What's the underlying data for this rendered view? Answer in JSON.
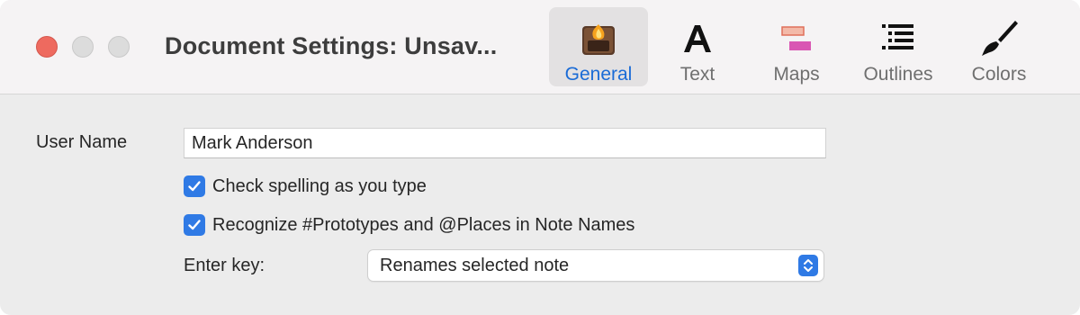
{
  "window": {
    "title": "Document Settings: Unsav..."
  },
  "toolbar": {
    "tabs": [
      {
        "label": "General",
        "icon": "general-app-icon",
        "active": true
      },
      {
        "label": "Text",
        "icon": "text-icon",
        "active": false
      },
      {
        "label": "Maps",
        "icon": "maps-icon",
        "active": false
      },
      {
        "label": "Outlines",
        "icon": "outlines-icon",
        "active": false
      },
      {
        "label": "Colors",
        "icon": "brush-icon",
        "active": false
      }
    ]
  },
  "form": {
    "user_name_label": "User Name",
    "user_name_value": "Mark Anderson",
    "check_spelling_label": "Check spelling as you type",
    "check_spelling_checked": true,
    "recognize_label": "Recognize #Prototypes and @Places in Note Names",
    "recognize_checked": true,
    "enter_key_label": "Enter key:",
    "enter_key_value": "Renames selected note"
  },
  "colors": {
    "accent": "#2f7ae5",
    "active_tab_label": "#1a6bd6",
    "close_button": "#ee6a5f"
  }
}
